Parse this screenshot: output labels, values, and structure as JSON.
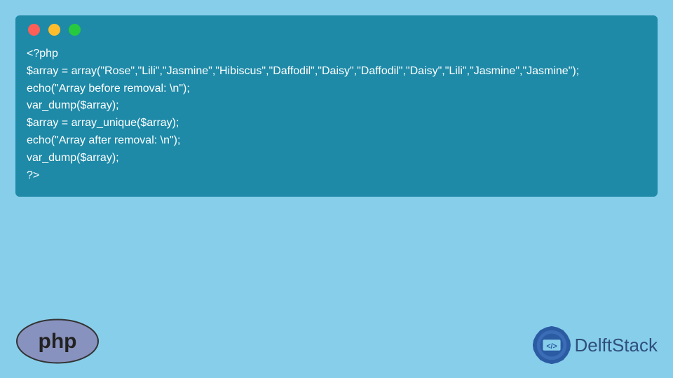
{
  "code": {
    "line1": "<?php",
    "line2": "$array = array(\"Rose\",\"Lili\",\"Jasmine\",\"Hibiscus\",\"Daffodil\",\"Daisy\",\"Daffodil\",\"Daisy\",\"Lili\",\"Jasmine\",\"Jasmine\");",
    "line3": "echo(\"Array before removal: \\n\");",
    "line4": "var_dump($array);",
    "line5": "$array = array_unique($array);",
    "line6": "echo(\"Array after removal: \\n\");",
    "line7": "var_dump($array);",
    "line8": "?>"
  },
  "logos": {
    "php_text": "php",
    "delft_text": "DelftStack",
    "badge_text": "</>"
  },
  "colors": {
    "page_bg": "#87ceeb",
    "panel_bg": "#1e8aa8",
    "code_text": "#ffffff",
    "php_ellipse": "#8892bf",
    "php_text": "#000000",
    "delft_text": "#2f4f7a",
    "gear": "#2b5ba3"
  }
}
